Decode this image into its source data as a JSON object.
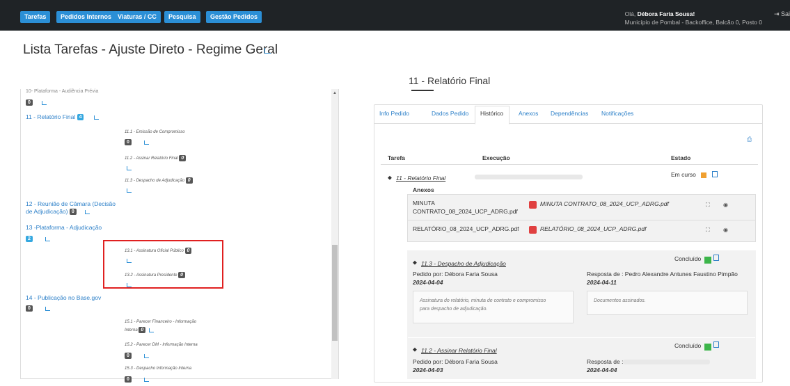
{
  "nav": [
    "Tarefas",
    "Pedidos Internos",
    "Viaturas / CC",
    "Pesquisa",
    "Gestão Pedidos"
  ],
  "user": {
    "greeting": "Olá,",
    "name": "Débora Faria Sousa!",
    "location": "Município de Pombal - Backoffice, Balcão 0, Posto 0",
    "logout": "Sai"
  },
  "page_title": "Lista Tarefas - Ajuste Direto - Regime Geral",
  "left": {
    "i10": "10- Plataforma - Audiência Prévia",
    "i10_badge": "0",
    "i11": "11 - Relatório Final",
    "i11_badge": "4",
    "s111": "11.1 - Emissão de Compromisso",
    "s111_b": "0",
    "s112": "11.2 - Assinar Relatório Final",
    "s112_b": "0",
    "s113": "11.3 - Despacho de Adjudicação",
    "s113_b": "0",
    "i12a": "12 - Reunião de Câmara (Decisão",
    "i12b": "de Adjudicação)",
    "i12_b": "0",
    "i13": "13 -Plataforma - Adjudicação",
    "i13_b": "2",
    "s131": "13.1 - Assinatura Oficial Público",
    "s131_b": "0",
    "s132": "13.2 - Assinatura Presidente",
    "s132_b": "0",
    "i14": "14 - Publicação no Base.gov",
    "i14_b": "0",
    "s151a": "15.1 - Parecer Financeiro - Informação",
    "s151b": "Interna",
    "s151_b": "0",
    "s152": "15.2 - Parecer DM - Informação Interna",
    "s152_b": "0",
    "s153": "15.3 - Despacho Informação Interna",
    "s153_b": "0"
  },
  "right": {
    "title": "11 - Relatório Final",
    "tabs": [
      "Info Pedido",
      "Dados Pedido",
      "Histórico",
      "Anexos",
      "Dependências",
      "Notificações"
    ],
    "col_tarefa": "Tarefa",
    "col_exec": "Execução",
    "col_estado": "Estado",
    "task": "11 - Relatório Final",
    "task_state": "Em curso",
    "anexos": "Anexos",
    "a1_name1": "MINUTA",
    "a1_name2": "CONTRATO_08_2024_UCP_ADRG.pdf",
    "a1_file": "MINUTA CONTRATO_08_2024_UCP_ADRG.pdf",
    "a2_name": "RELATÓRIO_08_2024_UCP_ADRG.pdf",
    "a2_file": "RELATÓRIO_08_2024_UCP_ADRG.pdf",
    "sub1": "11.3 - Despacho de Adjudicação",
    "sub1_state": "Concluído",
    "sub1_req": "Pedido por: Débora Faria Sousa",
    "sub1_date": "2024-04-04",
    "sub1_resp": "Resposta de : Pedro Alexandre Antunes Faustino Pimpão",
    "sub1_rdate": "2024-04-11",
    "sub1_note1a": "Assinatura do relatório, minuta de contrato e compromisso",
    "sub1_note1b": "para despacho de adjudicação.",
    "sub1_note2": "Documentos assinados.",
    "sub2": "11.2 - Assinar Relatório Final",
    "sub2_state": "Concluído",
    "sub2_req": "Pedido por: Débora Faria Sousa",
    "sub2_date": "2024-04-03",
    "sub2_resp": "Resposta de :",
    "sub2_rdate": "2024-04-04"
  },
  "colors": {
    "accent": "#2b8fd6",
    "alert": "#e02020",
    "concluded": "#3cb54a",
    "inprogress": "#f0a030"
  }
}
